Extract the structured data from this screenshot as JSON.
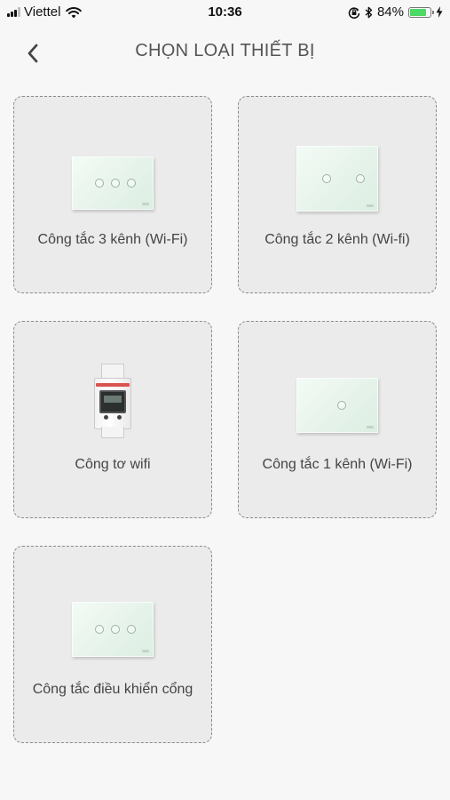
{
  "status_bar": {
    "carrier": "Viettel",
    "time": "10:36",
    "battery_percent": "84%",
    "battery_level": 0.84,
    "icons": [
      "signal-icon",
      "wifi-icon",
      "orientation-lock-icon",
      "bluetooth-icon",
      "battery-icon",
      "charging-icon"
    ]
  },
  "header": {
    "back_icon": "chevron-left-icon",
    "title": "CHỌN LOẠI THIẾT BỊ"
  },
  "devices": [
    {
      "label": "Công tắc 3 kênh (Wi-Fi)",
      "image": "switch-3-gang"
    },
    {
      "label": "Công tắc 2 kênh (Wi-fi)",
      "image": "switch-2-gang"
    },
    {
      "label": "Công tơ wifi",
      "image": "energy-meter"
    },
    {
      "label": "Công tắc 1 kênh (Wi-Fi)",
      "image": "switch-1-gang"
    },
    {
      "label": "Công tắc điều khiển cổng",
      "image": "switch-3-gang"
    }
  ],
  "colors": {
    "background": "#f7f7f7",
    "card_background": "#ebebeb",
    "card_border": "#8a8a8a",
    "battery_green": "#4cd964",
    "title_text": "#555555"
  }
}
